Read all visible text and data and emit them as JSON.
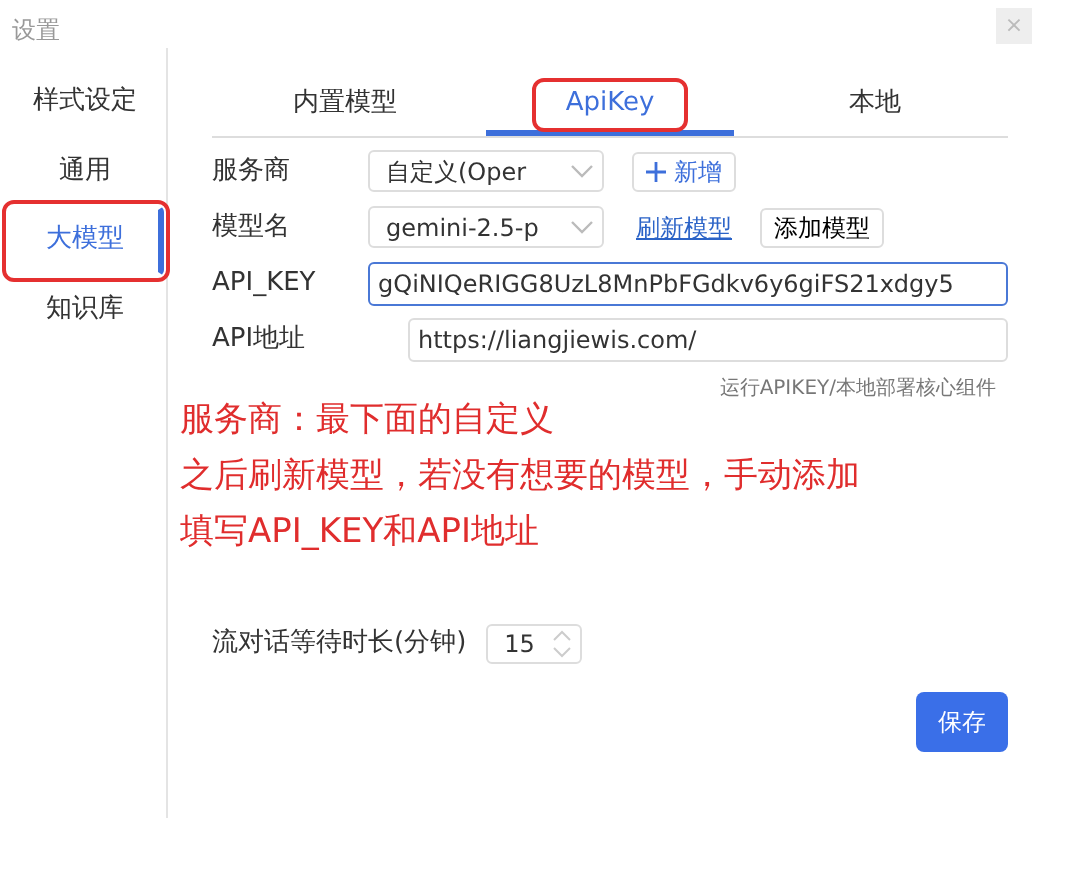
{
  "window": {
    "title": "设置",
    "close": "×"
  },
  "sidebar": {
    "items": [
      {
        "label": "样式设定",
        "selected": false,
        "highlighted": false
      },
      {
        "label": "通用",
        "selected": false,
        "highlighted": false
      },
      {
        "label": "大模型",
        "selected": true,
        "highlighted": true
      },
      {
        "label": "知识库",
        "selected": false,
        "highlighted": false
      }
    ]
  },
  "tabs": [
    {
      "label": "内置模型",
      "selected": false,
      "highlighted": false
    },
    {
      "label": "ApiKey",
      "selected": true,
      "highlighted": true
    },
    {
      "label": "本地",
      "selected": false,
      "highlighted": false
    }
  ],
  "form": {
    "provider": {
      "label": "服务商",
      "value": "自定义(Oper",
      "add_button": "新增"
    },
    "model": {
      "label": "模型名",
      "value": "gemini-2.5-p",
      "refresh_link": "刷新模型",
      "add_button": "添加模型"
    },
    "api_key": {
      "label": "API_KEY",
      "value": "gQiNIQeRIGG8UzL8MnPbFGdkv6y6giFS21xdgy5",
      "focused": true
    },
    "api_url": {
      "label": "API地址",
      "value": "https://liangjiewis.com/"
    },
    "caption": "运行APIKEY/本地部署核心组件"
  },
  "annotation": [
    "服务商：最下面的自定义",
    "之后刷新模型，若没有想要的模型，手动添加",
    "填写API_KEY和API地址"
  ],
  "wait_time": {
    "label": "流对话等待时长(分钟)",
    "value": "15"
  },
  "save_button": "保存"
}
